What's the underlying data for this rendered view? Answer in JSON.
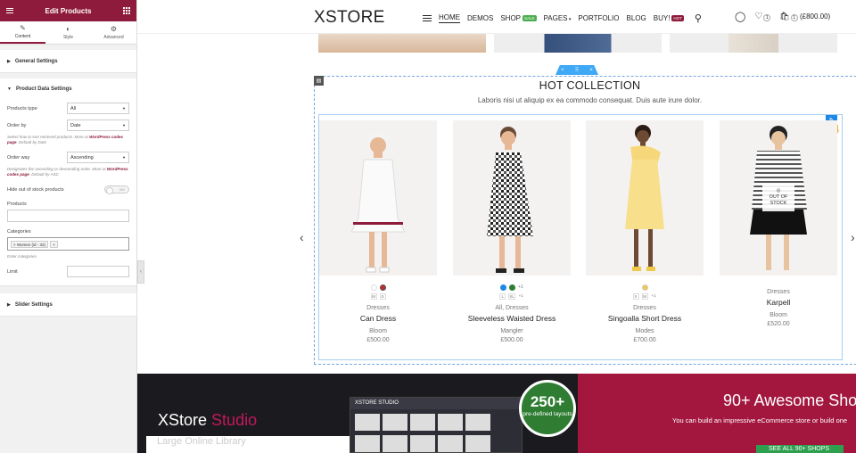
{
  "editor": {
    "title": "Edit Products",
    "tabs": [
      {
        "label": "Content",
        "icon": "pencil-icon"
      },
      {
        "label": "Style",
        "icon": "half-circle-icon"
      },
      {
        "label": "Advanced",
        "icon": "gear-icon"
      }
    ],
    "sections": {
      "general": "General Settings",
      "product_data": "Product Data Settings",
      "slider": "Slider Settings"
    },
    "fields": {
      "products_type_label": "Products type",
      "products_type_value": "All",
      "order_by_label": "Order by",
      "order_by_value": "Date",
      "order_by_help_pre": "Select how to sort retrieved products. More at",
      "order_by_help_link": "WordPress codex page",
      "order_by_help_post": ". Default by Date",
      "order_way_label": "Order way",
      "order_way_value": "Ascending",
      "order_way_help_pre": "Designates the ascending or descending order. More at",
      "order_way_help_link": "WordPress codex page",
      "order_way_help_post": ". Default by ASC",
      "hide_oos_label": "Hide out of stock products",
      "hide_oos_value": "NO",
      "products_label": "Products",
      "categories_label": "Categories",
      "category_chip": "× Women (id - 32)",
      "category_chip2": "×",
      "categories_help": "Enter categories.",
      "limit_label": "Limit"
    }
  },
  "header": {
    "logo": "XSTORE",
    "nav": [
      "HOME",
      "DEMOS",
      "SHOP",
      "PAGES",
      "PORTFOLIO",
      "BLOG",
      "BUY!"
    ],
    "shop_badge": "SALE",
    "pages_badge": "NEW",
    "buy_badge": "HOT",
    "wishlist_count": "1",
    "cart_count": "1",
    "cart_total": "(£800.00)"
  },
  "section": {
    "title": "HOT COLLECTION",
    "subtitle": "Laboris nisi ut aliquip ex ea commodo consequat. Duis aute irure dolor."
  },
  "products": [
    {
      "category": "Dresses",
      "name": "Can Dress",
      "brand": "Bloom",
      "price": "£500.00",
      "sizes": [
        "M",
        "S"
      ],
      "colors": [
        "#ffffff",
        "#c62828"
      ],
      "more": ""
    },
    {
      "category": "All, Dresses",
      "name": "Sleeveless Waisted Dress",
      "brand": "Mangler",
      "price": "£500.00",
      "sizes": [
        "L",
        "XL"
      ],
      "colors": [
        "#1e88e5",
        "#2e7d32"
      ],
      "more": "+1"
    },
    {
      "category": "Dresses",
      "name": "Singoalla Short Dress",
      "brand": "Modes",
      "price": "£700.00",
      "sizes": [
        "X",
        "M"
      ],
      "colors": [
        "#f2c94c"
      ],
      "more": "+1"
    },
    {
      "category": "Dresses",
      "name": "Karpell",
      "brand": "Bloom",
      "price": "£520.00",
      "sizes": [],
      "colors": [],
      "more": "",
      "oos": "OUT OF STOCK"
    }
  ],
  "banner": {
    "brand": "XStore",
    "studio": "Studio",
    "library": "Large Online Library",
    "mock_title": "XSTORE STUDIO",
    "badge_number": "250+",
    "badge_text": "pre-defined layouts",
    "headline": "90+ Awesome Sho",
    "sub": "You can build an impressive eCommerce store or build one",
    "button": "SEE ALL 90+ SHOPS"
  },
  "colors": {
    "accent": "#8e1b3b",
    "link": "#1e88e5"
  }
}
